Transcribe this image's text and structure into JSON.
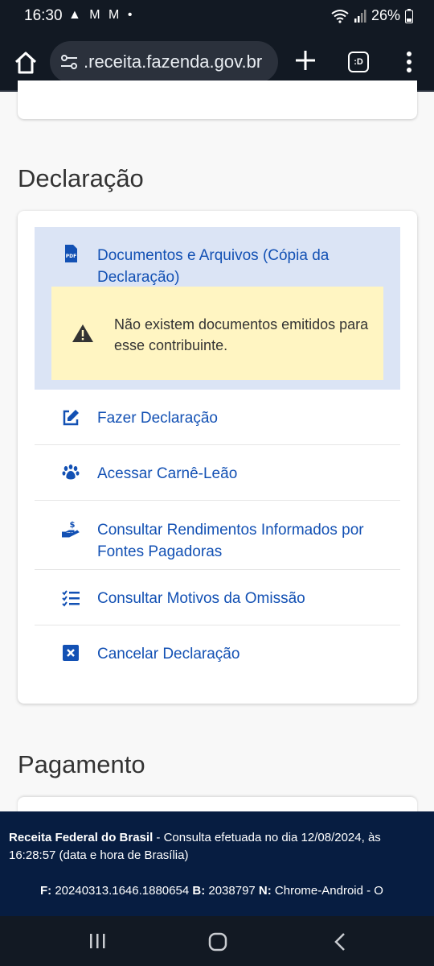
{
  "status_bar": {
    "time": "16:30",
    "indicators": "▲ M M •",
    "battery": "26%"
  },
  "browser": {
    "url": ".receita.fazenda.gov.br",
    "tab_count": ":D"
  },
  "sections": {
    "declaracao_title": "Declaração",
    "pagamento_title": "Pagamento"
  },
  "declaracao_items": [
    {
      "label": "Documentos e Arquivos (Cópia da Declaração)",
      "icon": "pdf-icon"
    },
    {
      "label": "Fazer Declaração",
      "icon": "edit-icon"
    },
    {
      "label": "Acessar Carnê-Leão",
      "icon": "paw-icon"
    },
    {
      "label": "Consultar Rendimentos Informados por Fontes Pagadoras",
      "icon": "hand-dollar-icon"
    },
    {
      "label": "Consultar Motivos da Omissão",
      "icon": "checklist-icon"
    },
    {
      "label": "Cancelar Declaração",
      "icon": "close-square-icon"
    }
  ],
  "alert": {
    "message": "Não existem documentos emitidos para esse contribuinte."
  },
  "footer": {
    "org": "Receita Federal do Brasil",
    "text": " - Consulta efetuada no dia 12/08/2024, às 16:28:57 (data e hora de Brasília)",
    "f_label": "F:",
    "f_value": " 20240313.1646.1880654 ",
    "b_label": "B:",
    "b_value": " 2038797 ",
    "n_label": "N:",
    "n_value": " Chrome-Android - O"
  },
  "colors": {
    "link": "#1351b4",
    "footer_bg": "#071d41",
    "alert_bg": "#fff5c2",
    "active_bg": "#dbe4f5"
  }
}
